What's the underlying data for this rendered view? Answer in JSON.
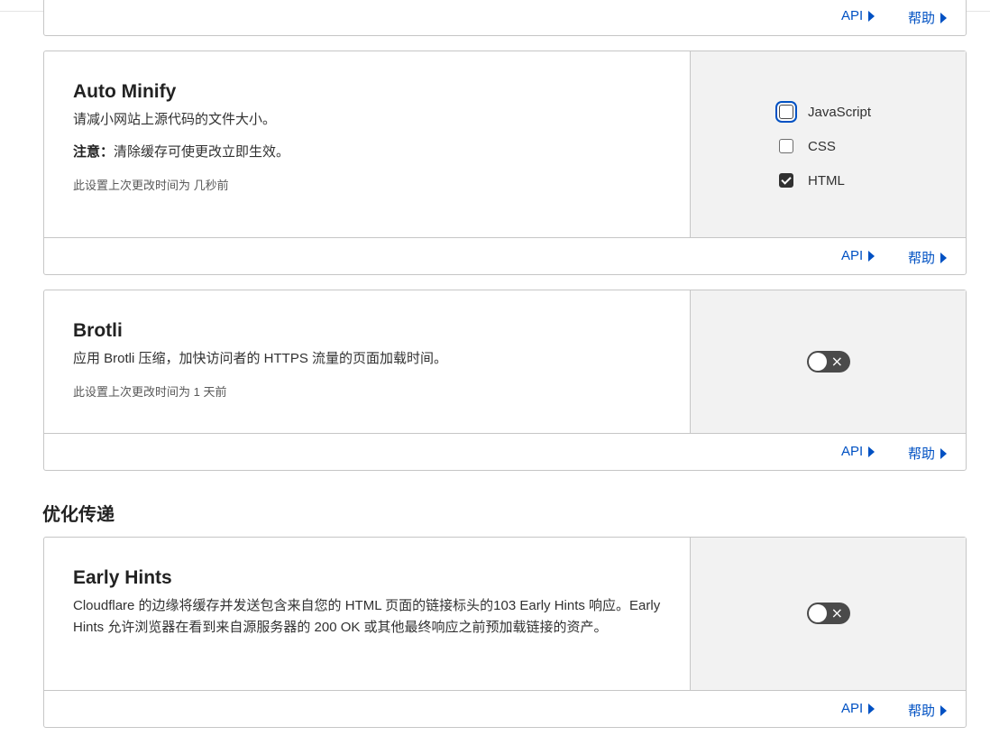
{
  "top_card": {
    "api_label": "API",
    "help_label": "帮助"
  },
  "auto_minify": {
    "title": "Auto Minify",
    "description": "请减小网站上源代码的文件大小。",
    "note_label": "注意：",
    "note_text": "清除缓存可使更改立即生效。",
    "meta": "此设置上次更改时间为 几秒前",
    "options": [
      {
        "label": "JavaScript",
        "checked": false,
        "focused": true
      },
      {
        "label": "CSS",
        "checked": false,
        "focused": false
      },
      {
        "label": "HTML",
        "checked": true,
        "focused": false
      }
    ],
    "api_label": "API",
    "help_label": "帮助"
  },
  "brotli": {
    "title": "Brotli",
    "description": "应用 Brotli 压缩，加快访问者的 HTTPS 流量的页面加载时间。",
    "meta": "此设置上次更改时间为 1 天前",
    "toggle_on": false,
    "toggle_icon": "×",
    "api_label": "API",
    "help_label": "帮助"
  },
  "section": {
    "title": "优化传递"
  },
  "early_hints": {
    "title": "Early Hints",
    "description": "Cloudflare 的边缘将缓存并发送包含来自您的 HTML 页面的链接标头的103 Early Hints 响应。Early Hints 允许浏览器在看到来自源服务器的 200 OK 或其他最终响应之前预加载链接的资产。",
    "toggle_on": false,
    "toggle_icon": "×",
    "api_label": "API",
    "help_label": "帮助"
  },
  "colors": {
    "link": "#0051c3",
    "toggle_off": "#4a4a4a",
    "panel_bg": "#f2f2f2"
  }
}
